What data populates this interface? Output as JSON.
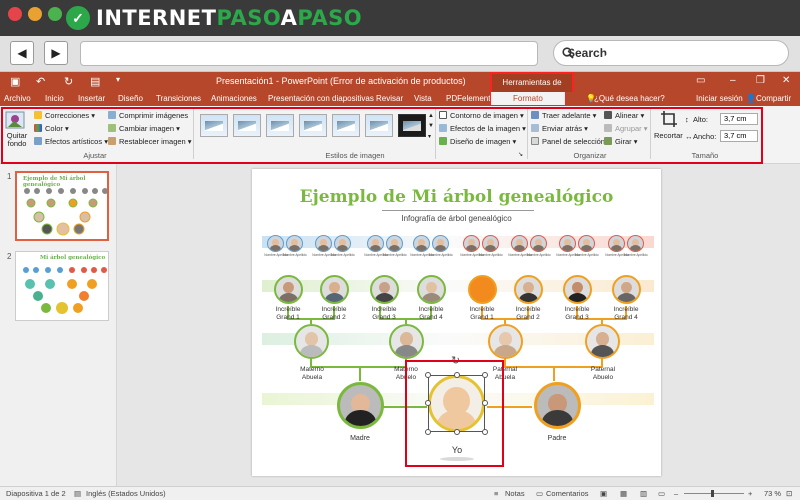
{
  "browser": {
    "logo": {
      "part1": "INTERNET",
      "part2": "PASO",
      "part3": "A",
      "part4": "PASO"
    },
    "search": {
      "placeholder": "Search"
    },
    "traffic_colors": [
      "#e5454a",
      "#e9a232",
      "#4bb24f"
    ]
  },
  "app": {
    "title": "Presentación1 - PowerPoint (Error de activación de productos)",
    "context_header": "Herramientas de imagen",
    "sign_in": "Iniciar sesión",
    "share": "Compartir",
    "tell_me": "¿Qué desea hacer?",
    "accent_color": "#b7472a"
  },
  "tabs": [
    "Archivo",
    "Inicio",
    "Insertar",
    "Diseño",
    "Transiciones",
    "Animaciones",
    "Presentación con diapositivas",
    "Revisar",
    "Vista",
    "PDFelement",
    "Formato"
  ],
  "ribbon": {
    "ajustar": {
      "quitar": "Quitar fondo",
      "correcciones": "Correcciones",
      "color": "Color",
      "efectos": "Efectos artísticos",
      "comprimir": "Comprimir imágenes",
      "cambiar": "Cambiar imagen",
      "restablecer": "Restablecer imagen",
      "label": "Ajustar"
    },
    "estilos": {
      "label": "Estilos de imagen"
    },
    "estilos2": {
      "contorno": "Contorno de imagen",
      "efectos": "Efectos de la imagen",
      "diseno": "Diseño de imagen"
    },
    "organizar": {
      "traer": "Traer adelante",
      "enviar": "Enviar atrás",
      "panel": "Panel de selección",
      "alinear": "Alinear",
      "agrupar": "Agrupar",
      "girar": "Girar",
      "label": "Organizar"
    },
    "tamano": {
      "recortar": "Recortar",
      "alto_label": "Alto:",
      "alto": "3,7 cm",
      "ancho_label": "Ancho:",
      "ancho": "3,7 cm",
      "label": "Tamaño"
    }
  },
  "slides_panel": {
    "items": [
      {
        "num": "1",
        "title": "Ejemplo de Mi árbol genealógico"
      },
      {
        "num": "2",
        "title": "Mi árbol genealógico"
      }
    ]
  },
  "slide": {
    "title": "Ejemplo de Mi árbol genealógico",
    "subtitle": "Infografía de árbol genealógico",
    "small_name": "Nombre Apellido",
    "row2": [
      "Increíble Grand 1",
      "Increíble Grand 2",
      "Increíble Grand 3",
      "Increíble Grand 4",
      "Increíble Grand 1",
      "Increíble Grand 2",
      "Increíble Grand 3",
      "Increíble Grand 4"
    ],
    "row3": [
      "Materno Abuela",
      "Materno Abuelo",
      "Paternal Abuela",
      "Paternal Abuelo"
    ],
    "madre": "Madre",
    "padre": "Padre",
    "yo": "Yo",
    "colors": {
      "green": "#7ab93e",
      "orange": "#f0a020",
      "yellow": "#e5c230",
      "blue": "#5a9fd4",
      "red": "#e05a4a"
    }
  },
  "status": {
    "slide": "Diapositiva 1 de 2",
    "lang": "Inglés (Estados Unidos)",
    "notas": "Notas",
    "comentarios": "Comentarios",
    "zoom": "73 %"
  }
}
